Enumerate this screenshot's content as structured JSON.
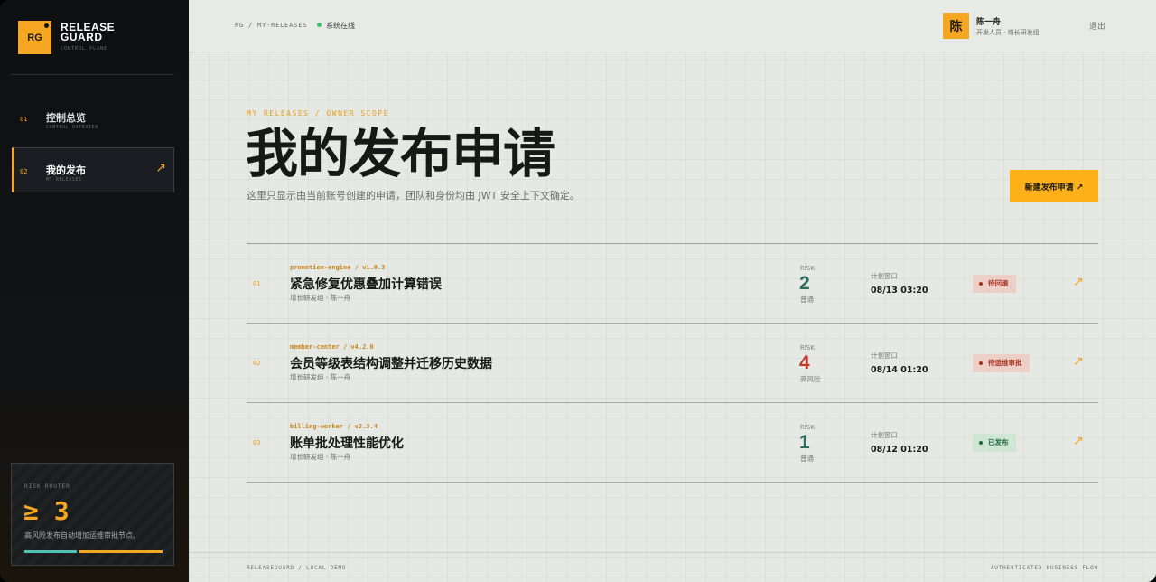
{
  "brand": {
    "logo_text": "RG",
    "name": "RELEASE\nGUARD",
    "subtitle": "CONTROL PLANE"
  },
  "sidebar": {
    "items": [
      {
        "num": "01",
        "label": "控制总览",
        "sub": "CONTROL OVERVIEW",
        "active": false
      },
      {
        "num": "02",
        "label": "我的发布",
        "sub": "MY RELEASES",
        "active": true,
        "arrow": "↗"
      }
    ],
    "risk_card": {
      "title": "RISK ROUTER",
      "value": "≥ 3",
      "desc": "高风险发布自动增加运维审批节点。"
    }
  },
  "topbar": {
    "breadcrumb": "RG / MY-RELEASES",
    "status": "系统在线",
    "user": {
      "avatar": "陈",
      "name": "陈一舟",
      "role": "开发人员 · 增长研发组"
    },
    "logout": "退出"
  },
  "main": {
    "eyebrow": "MY RELEASES / OWNER SCOPE",
    "title": "我的发布申请",
    "desc": "这里只显示由当前账号创建的申请，团队和身份均由 JWT 安全上下文确定。",
    "new_button": "新建发布申请 ↗"
  },
  "releases": [
    {
      "num": "01",
      "service": "promotion-engine / v1.9.3",
      "title": "紧急修复优惠叠加计算错误",
      "meta": "增长研发组 · 陈一舟",
      "risk_label": "RISK",
      "risk": "2",
      "risk_level": "普通",
      "window_label": "计划窗口",
      "window": "08/13 03:20",
      "status": "待回滚",
      "arrow": "↗"
    },
    {
      "num": "02",
      "service": "member-center / v4.2.0",
      "title": "会员等级表结构调整并迁移历史数据",
      "meta": "增长研发组 · 陈一舟",
      "risk_label": "RISK",
      "risk": "4",
      "risk_level": "高风险",
      "window_label": "计划窗口",
      "window": "08/14 01:20",
      "status": "待运维审批",
      "arrow": "↗"
    },
    {
      "num": "03",
      "service": "billing-worker / v2.3.4",
      "title": "账单批处理性能优化",
      "meta": "增长研发组 · 陈一舟",
      "risk_label": "RISK",
      "risk": "1",
      "risk_level": "普通",
      "window_label": "计划窗口",
      "window": "08/12 01:20",
      "status": "已发布",
      "arrow": "↗"
    }
  ],
  "footer": {
    "left": "RELEASEGUARD / LOCAL DEMO",
    "right": "AUTHENTICATED BUSINESS FLOW"
  },
  "colors": {
    "accent": "#f5a623",
    "risk_normal": "#2e6b5f",
    "risk_high": "#c0392b"
  }
}
